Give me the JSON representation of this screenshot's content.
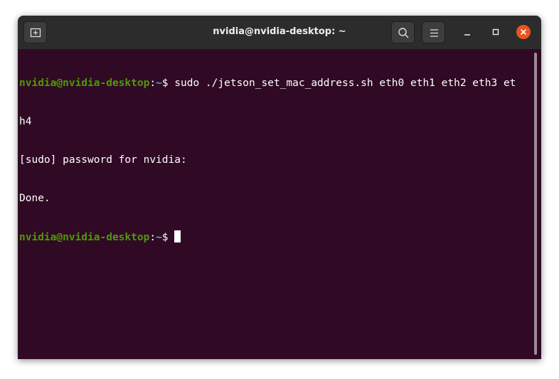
{
  "window": {
    "title": "nvidia@nvidia-desktop: ~"
  },
  "icons": {
    "new_tab": "new-tab-icon",
    "search": "search-icon",
    "menu": "hamburger-menu-icon",
    "minimize": "minimize-icon",
    "maximize": "maximize-icon",
    "close": "close-icon"
  },
  "colors": {
    "terminal_background": "#300a24",
    "prompt_user": "#4e9a06",
    "prompt_path": "#729fcf",
    "close_button": "#e95420"
  },
  "terminal": {
    "prompt_user": "nvidia@nvidia-desktop",
    "prompt_colon": ":",
    "prompt_path": "~",
    "prompt_dollar": "$ ",
    "command_line_1": "sudo ./jetson_set_mac_address.sh eth0 eth1 eth2 eth3 et",
    "command_line_2": "h4",
    "output_1": "[sudo] password for nvidia:",
    "output_2": "Done."
  }
}
